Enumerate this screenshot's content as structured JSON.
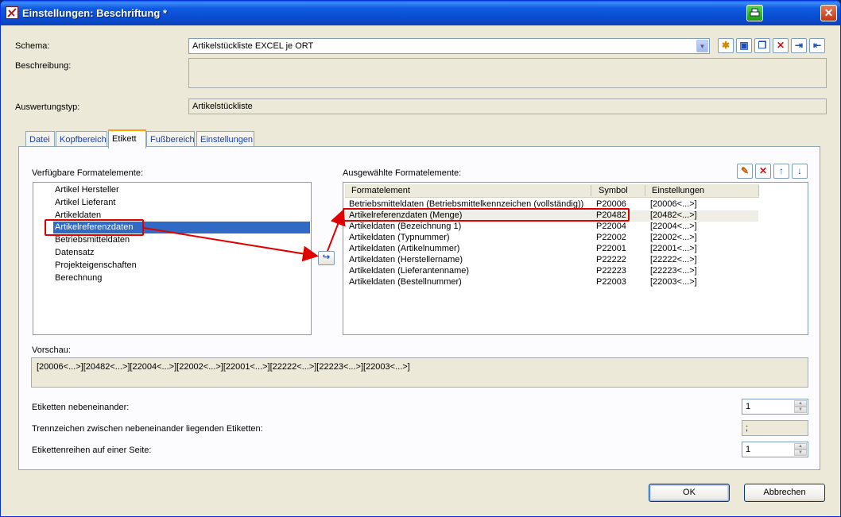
{
  "window": {
    "title": "Einstellungen: Beschriftung *"
  },
  "schema": {
    "label": "Schema:",
    "value": "Artikelstückliste EXCEL je ORT"
  },
  "beschreibung": {
    "label": "Beschreibung:",
    "value": ""
  },
  "auswertungstyp": {
    "label": "Auswertungstyp:",
    "value": "Artikelstückliste"
  },
  "tabs": [
    "Datei",
    "Kopfbereich",
    "Etikett",
    "Fußbereich",
    "Einstellungen"
  ],
  "available": {
    "label": "Verfügbare Formatelemente:",
    "items": [
      "Artikel Hersteller",
      "Artikel Lieferant",
      "Artikeldaten",
      "Artikelreferenzdaten",
      "Betriebsmitteldaten",
      "Datensatz",
      "Projekteigenschaften",
      "Berechnung"
    ]
  },
  "selected": {
    "label": "Ausgewählte Formatelemente:",
    "columns": [
      "Formatelement",
      "Symbol",
      "Einstellungen"
    ],
    "rows": [
      [
        "Betriebsmitteldaten (Betriebsmittelkennzeichen (vollständig))",
        "P20006",
        "[20006<...>]"
      ],
      [
        "Artikelreferenzdaten (Menge)",
        "P20482",
        "[20482<...>]"
      ],
      [
        "Artikeldaten (Bezeichnung 1)",
        "P22004",
        "[22004<...>]"
      ],
      [
        "Artikeldaten (Typnummer)",
        "P22002",
        "[22002<...>]"
      ],
      [
        "Artikeldaten (Artikelnummer)",
        "P22001",
        "[22001<...>]"
      ],
      [
        "Artikeldaten (Herstellername)",
        "P22222",
        "[22222<...>]"
      ],
      [
        "Artikeldaten (Lieferantenname)",
        "P22223",
        "[22223<...>]"
      ],
      [
        "Artikeldaten (Bestellnummer)",
        "P22003",
        "[22003<...>]"
      ]
    ]
  },
  "vorschau": {
    "label": "Vorschau:",
    "value": "[20006<...>][20482<...>][22004<...>][22002<...>][22001<...>][22222<...>][22223<...>][22003<...>]"
  },
  "settings": {
    "nebeneinander": {
      "label": "Etiketten nebeneinander:",
      "value": "1"
    },
    "trennzeichen": {
      "label": "Trennzeichen zwischen nebeneinander liegenden Etiketten:",
      "value": ";"
    },
    "reihen": {
      "label": "Etikettenreihen auf einer Seite:",
      "value": "1"
    }
  },
  "buttons": {
    "ok": "OK",
    "cancel": "Abbrechen"
  }
}
